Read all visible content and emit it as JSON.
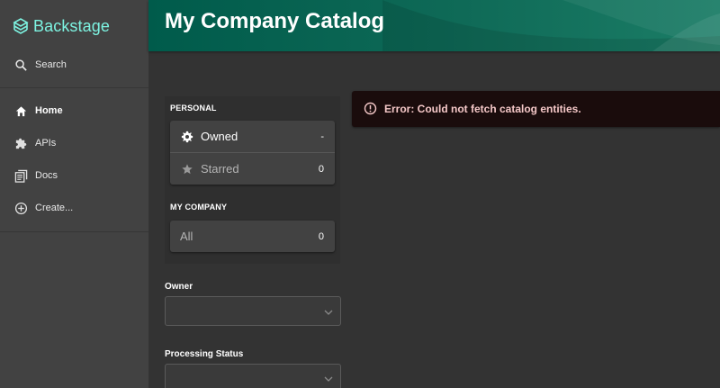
{
  "sidebar": {
    "logo_text": "Backstage",
    "search_label": "Search",
    "items": [
      {
        "label": "Home",
        "icon": "home-icon"
      },
      {
        "label": "APIs",
        "icon": "puzzle-icon"
      },
      {
        "label": "Docs",
        "icon": "docs-icon"
      },
      {
        "label": "Create...",
        "icon": "add-circle-icon"
      }
    ]
  },
  "header": {
    "title": "My Company Catalog"
  },
  "filters": {
    "personal_title": "PERSONAL",
    "owned": {
      "label": "Owned",
      "count": "-",
      "icon": "gear-icon"
    },
    "starred": {
      "label": "Starred",
      "count": "0",
      "icon": "star-icon"
    },
    "company_title": "MY COMPANY",
    "all": {
      "label": "All",
      "count": "0"
    }
  },
  "owner": {
    "label": "Owner",
    "value": ""
  },
  "processing_status": {
    "label": "Processing Status",
    "value": ""
  },
  "error": {
    "message": "Error: Could not fetch catalog entities."
  },
  "colors": {
    "accent": "#7df3e1",
    "header": "#005b4b",
    "sidebar": "#424242",
    "background": "#333333",
    "error_bg": "#1a0c0c",
    "error_text": "#f4c7c7"
  }
}
